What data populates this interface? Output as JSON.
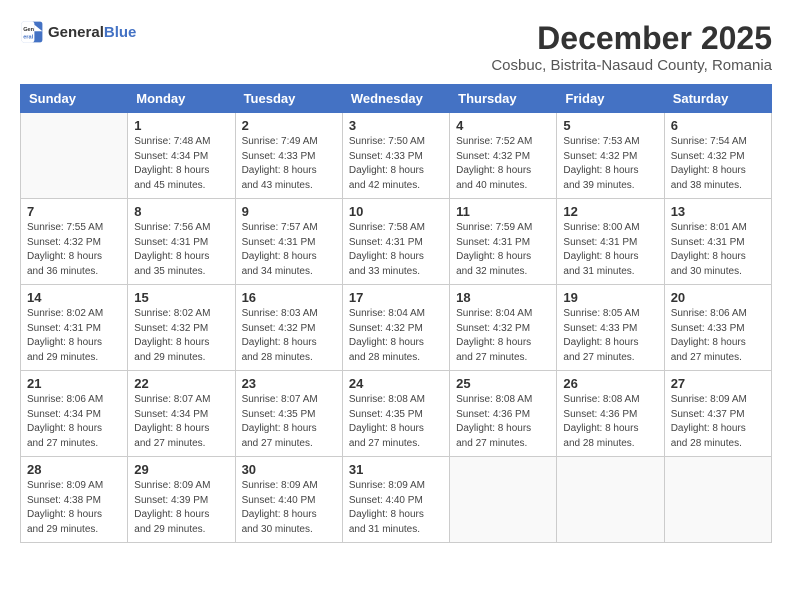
{
  "logo": {
    "text_general": "General",
    "text_blue": "Blue"
  },
  "title": "December 2025",
  "subtitle": "Cosbuc, Bistrita-Nasaud County, Romania",
  "days_of_week": [
    "Sunday",
    "Monday",
    "Tuesday",
    "Wednesday",
    "Thursday",
    "Friday",
    "Saturday"
  ],
  "weeks": [
    [
      {
        "day": "",
        "info": ""
      },
      {
        "day": "1",
        "info": "Sunrise: 7:48 AM\nSunset: 4:34 PM\nDaylight: 8 hours\nand 45 minutes."
      },
      {
        "day": "2",
        "info": "Sunrise: 7:49 AM\nSunset: 4:33 PM\nDaylight: 8 hours\nand 43 minutes."
      },
      {
        "day": "3",
        "info": "Sunrise: 7:50 AM\nSunset: 4:33 PM\nDaylight: 8 hours\nand 42 minutes."
      },
      {
        "day": "4",
        "info": "Sunrise: 7:52 AM\nSunset: 4:32 PM\nDaylight: 8 hours\nand 40 minutes."
      },
      {
        "day": "5",
        "info": "Sunrise: 7:53 AM\nSunset: 4:32 PM\nDaylight: 8 hours\nand 39 minutes."
      },
      {
        "day": "6",
        "info": "Sunrise: 7:54 AM\nSunset: 4:32 PM\nDaylight: 8 hours\nand 38 minutes."
      }
    ],
    [
      {
        "day": "7",
        "info": "Sunrise: 7:55 AM\nSunset: 4:32 PM\nDaylight: 8 hours\nand 36 minutes."
      },
      {
        "day": "8",
        "info": "Sunrise: 7:56 AM\nSunset: 4:31 PM\nDaylight: 8 hours\nand 35 minutes."
      },
      {
        "day": "9",
        "info": "Sunrise: 7:57 AM\nSunset: 4:31 PM\nDaylight: 8 hours\nand 34 minutes."
      },
      {
        "day": "10",
        "info": "Sunrise: 7:58 AM\nSunset: 4:31 PM\nDaylight: 8 hours\nand 33 minutes."
      },
      {
        "day": "11",
        "info": "Sunrise: 7:59 AM\nSunset: 4:31 PM\nDaylight: 8 hours\nand 32 minutes."
      },
      {
        "day": "12",
        "info": "Sunrise: 8:00 AM\nSunset: 4:31 PM\nDaylight: 8 hours\nand 31 minutes."
      },
      {
        "day": "13",
        "info": "Sunrise: 8:01 AM\nSunset: 4:31 PM\nDaylight: 8 hours\nand 30 minutes."
      }
    ],
    [
      {
        "day": "14",
        "info": "Sunrise: 8:02 AM\nSunset: 4:31 PM\nDaylight: 8 hours\nand 29 minutes."
      },
      {
        "day": "15",
        "info": "Sunrise: 8:02 AM\nSunset: 4:32 PM\nDaylight: 8 hours\nand 29 minutes."
      },
      {
        "day": "16",
        "info": "Sunrise: 8:03 AM\nSunset: 4:32 PM\nDaylight: 8 hours\nand 28 minutes."
      },
      {
        "day": "17",
        "info": "Sunrise: 8:04 AM\nSunset: 4:32 PM\nDaylight: 8 hours\nand 28 minutes."
      },
      {
        "day": "18",
        "info": "Sunrise: 8:04 AM\nSunset: 4:32 PM\nDaylight: 8 hours\nand 27 minutes."
      },
      {
        "day": "19",
        "info": "Sunrise: 8:05 AM\nSunset: 4:33 PM\nDaylight: 8 hours\nand 27 minutes."
      },
      {
        "day": "20",
        "info": "Sunrise: 8:06 AM\nSunset: 4:33 PM\nDaylight: 8 hours\nand 27 minutes."
      }
    ],
    [
      {
        "day": "21",
        "info": "Sunrise: 8:06 AM\nSunset: 4:34 PM\nDaylight: 8 hours\nand 27 minutes."
      },
      {
        "day": "22",
        "info": "Sunrise: 8:07 AM\nSunset: 4:34 PM\nDaylight: 8 hours\nand 27 minutes."
      },
      {
        "day": "23",
        "info": "Sunrise: 8:07 AM\nSunset: 4:35 PM\nDaylight: 8 hours\nand 27 minutes."
      },
      {
        "day": "24",
        "info": "Sunrise: 8:08 AM\nSunset: 4:35 PM\nDaylight: 8 hours\nand 27 minutes."
      },
      {
        "day": "25",
        "info": "Sunrise: 8:08 AM\nSunset: 4:36 PM\nDaylight: 8 hours\nand 27 minutes."
      },
      {
        "day": "26",
        "info": "Sunrise: 8:08 AM\nSunset: 4:36 PM\nDaylight: 8 hours\nand 28 minutes."
      },
      {
        "day": "27",
        "info": "Sunrise: 8:09 AM\nSunset: 4:37 PM\nDaylight: 8 hours\nand 28 minutes."
      }
    ],
    [
      {
        "day": "28",
        "info": "Sunrise: 8:09 AM\nSunset: 4:38 PM\nDaylight: 8 hours\nand 29 minutes."
      },
      {
        "day": "29",
        "info": "Sunrise: 8:09 AM\nSunset: 4:39 PM\nDaylight: 8 hours\nand 29 minutes."
      },
      {
        "day": "30",
        "info": "Sunrise: 8:09 AM\nSunset: 4:40 PM\nDaylight: 8 hours\nand 30 minutes."
      },
      {
        "day": "31",
        "info": "Sunrise: 8:09 AM\nSunset: 4:40 PM\nDaylight: 8 hours\nand 31 minutes."
      },
      {
        "day": "",
        "info": ""
      },
      {
        "day": "",
        "info": ""
      },
      {
        "day": "",
        "info": ""
      }
    ]
  ]
}
